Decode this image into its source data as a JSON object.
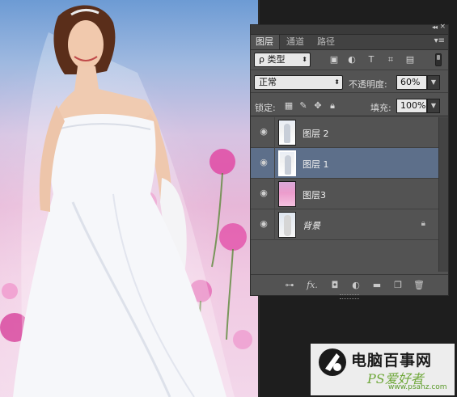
{
  "layers_panel": {
    "tabs": [
      {
        "label": "图层",
        "active": true
      },
      {
        "label": "通道",
        "active": false
      },
      {
        "label": "路径",
        "active": false
      }
    ],
    "filter": {
      "label": "ρ 类型"
    },
    "blend_mode": "正常",
    "opacity_label": "不透明度:",
    "opacity_value": "60%",
    "lock_label": "锁定:",
    "fill_label": "填充:",
    "fill_value": "100%",
    "layers": [
      {
        "name": "图层 2",
        "visible": true,
        "selected": false,
        "thumb": "bride"
      },
      {
        "name": "图层 1",
        "visible": true,
        "selected": true,
        "thumb": "bride"
      },
      {
        "name": "图层3",
        "visible": true,
        "selected": false,
        "thumb": "flower"
      },
      {
        "name": "背景",
        "visible": true,
        "selected": false,
        "thumb": "background",
        "locked": true
      }
    ],
    "bottom_icons": [
      "link-icon",
      "fx-icon",
      "mask-icon",
      "adjustment-icon",
      "folder-icon",
      "new-layer-icon",
      "trash-icon"
    ],
    "fx_label": "fx."
  },
  "watermark": {
    "text1": "电脑百事网",
    "text2": "PS爱好者",
    "text3": "www.psahz.com"
  },
  "colors": {
    "panel_bg": "#535353",
    "selected_layer": "#5d6f8a",
    "watermark_green": "#6fa83a"
  }
}
